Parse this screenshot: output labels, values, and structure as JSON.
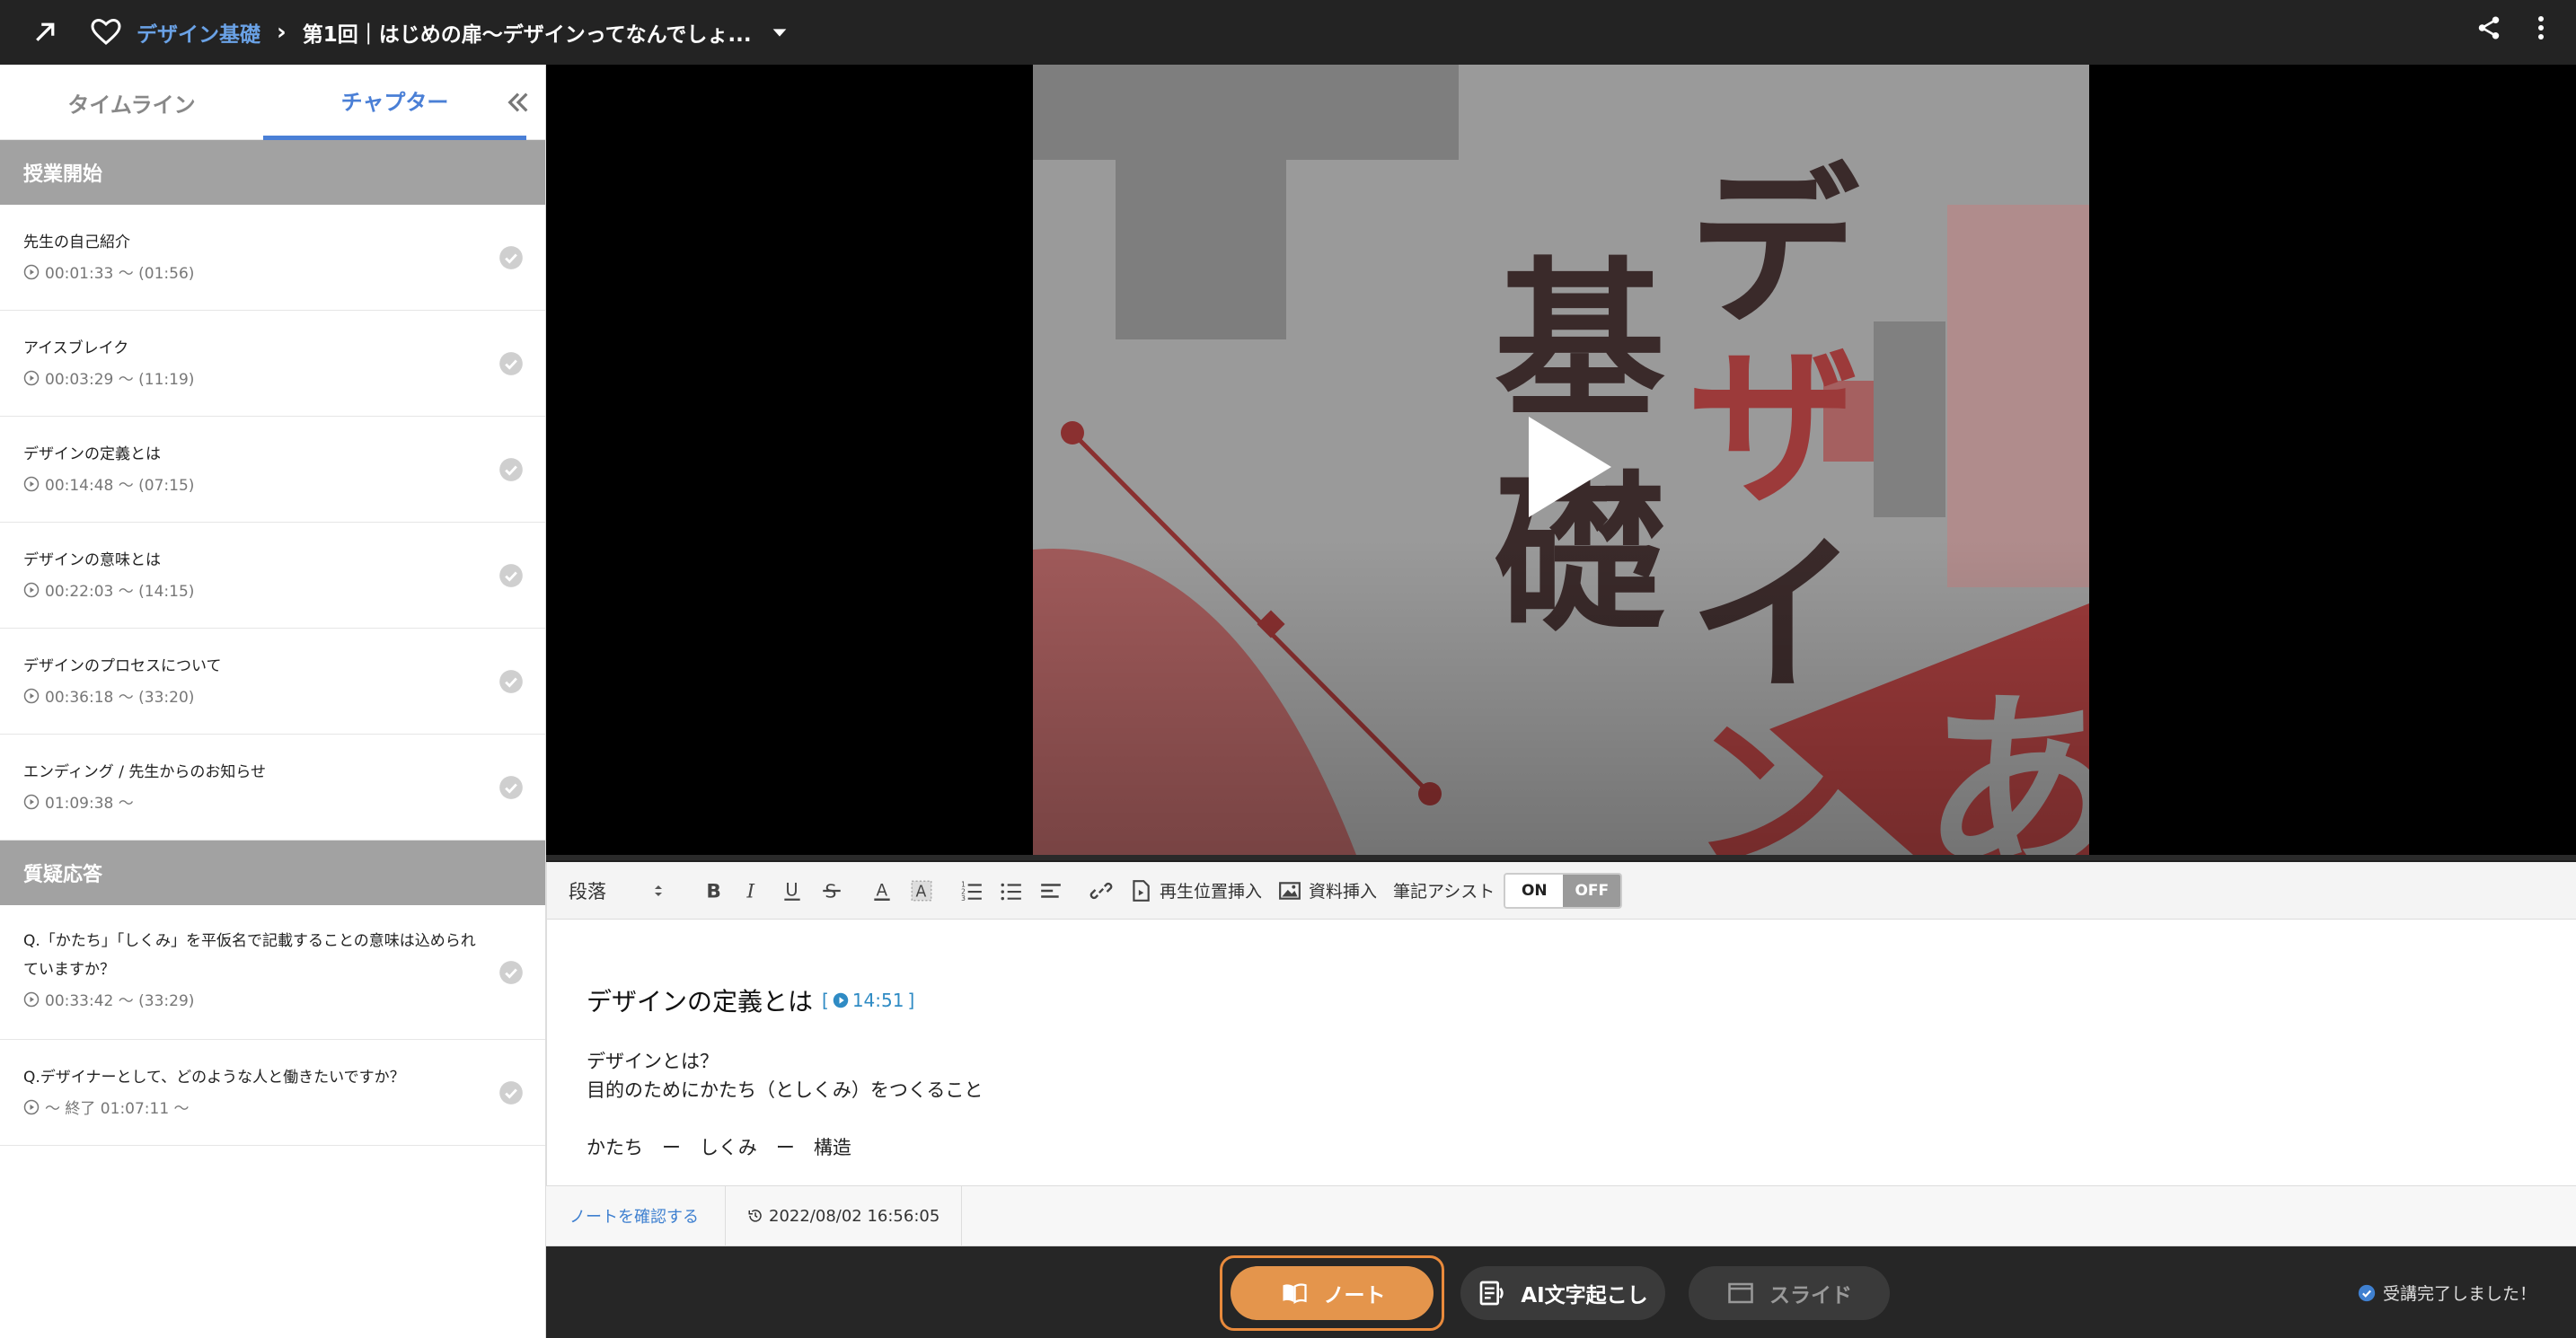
{
  "header": {
    "course_name": "デザイン基礎",
    "breadcrumb_separator": "›",
    "lesson_title": "第1回｜はじめの扉〜デザインってなんでしょ..."
  },
  "sidebar": {
    "tabs": [
      {
        "label": "タイムライン",
        "active": false
      },
      {
        "label": "チャプター",
        "active": true
      }
    ],
    "sections": [
      {
        "title": "授業開始",
        "chapters": [
          {
            "title": "先生の自己紹介",
            "time": "00:01:33 〜 (01:56)"
          },
          {
            "title": "アイスブレイク",
            "time": "00:03:29 〜 (11:19)"
          },
          {
            "title": "デザインの定義とは",
            "time": "00:14:48 〜 (07:15)"
          },
          {
            "title": "デザインの意味とは",
            "time": "00:22:03 〜 (14:15)"
          },
          {
            "title": "デザインのプロセスについて",
            "time": "00:36:18 〜 (33:20)"
          },
          {
            "title": "エンディング / 先生からのお知らせ",
            "time": "01:09:38 〜"
          }
        ]
      },
      {
        "title": "質疑応答",
        "chapters": [
          {
            "title_line1": "Q.「かたち」「しくみ」を平仮名で記載することの意味は込められ",
            "title_line2": "ていますか？",
            "time": "00:33:42 〜 (33:29)"
          },
          {
            "title": "Q.デザイナーとして、どのような人と働きたいですか？",
            "time": "〜 終了 01:07:11 〜"
          }
        ]
      }
    ]
  },
  "video": {
    "title_chars": [
      "デ",
      "ザ",
      "イ",
      "ン"
    ],
    "kanji": [
      "基",
      "礎"
    ],
    "hira": "あ",
    "colors": {
      "bg": "#9a9a9a",
      "dark": "#3a2a2a",
      "red": "#9c3a3a",
      "block": "#7e7e7e",
      "pink": "#b87878"
    }
  },
  "editor": {
    "toolbar": {
      "paragraph_label": "段落",
      "insert_position_label": "再生位置挿入",
      "insert_material_label": "資料挿入",
      "assist_label": "筆記アシスト",
      "toggle_on": "ON",
      "toggle_off": "OFF"
    },
    "note": {
      "heading": "デザインの定義とは",
      "timestamp": "14:51",
      "lines": [
        "デザインとは？",
        "目的のためにかたち（としくみ）をつくること",
        "",
        "かたち　ー　しくみ　ー　構造"
      ]
    },
    "footer": {
      "check_note_label": "ノートを確認する",
      "saved_time": "2022/08/02 16:56:05"
    }
  },
  "bottombar": {
    "note_label": "ノート",
    "ai_label": "AI文字起こし",
    "slide_label": "スライド",
    "complete_label": "受講完了しました！",
    "accent_color": "#e4954c"
  }
}
